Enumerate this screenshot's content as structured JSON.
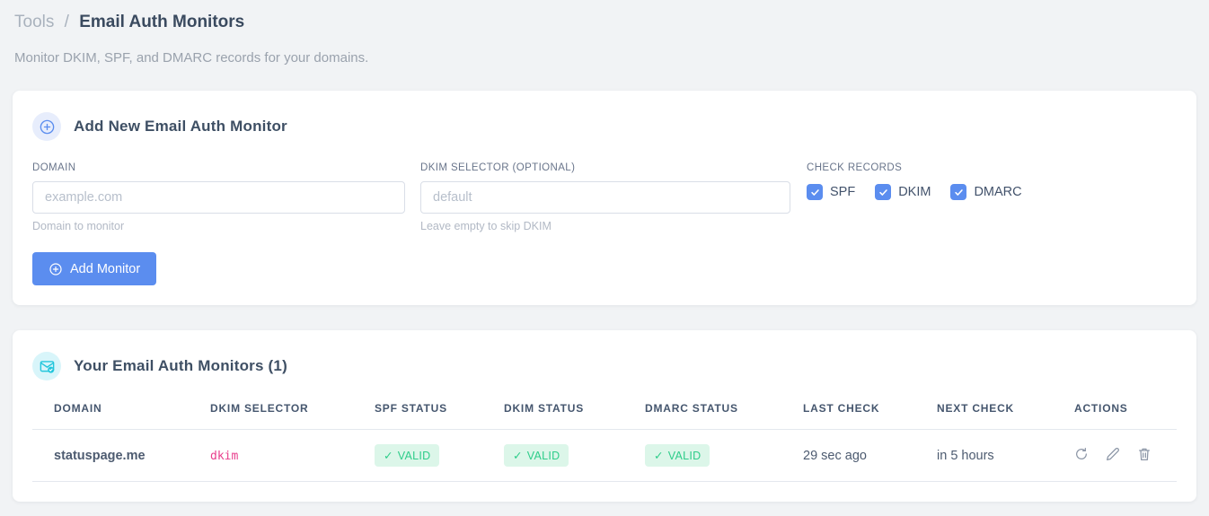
{
  "breadcrumb": {
    "parent": "Tools",
    "separator": "/",
    "current": "Email Auth Monitors"
  },
  "subtitle": "Monitor DKIM, SPF, and DMARC records for your domains.",
  "icons": {
    "check_glyph": "✓"
  },
  "add_form": {
    "title": "Add New Email Auth Monitor",
    "domain": {
      "label": "DOMAIN",
      "value": "",
      "placeholder": "example.com",
      "helper": "Domain to monitor"
    },
    "dkim_selector": {
      "label": "DKIM SELECTOR (OPTIONAL)",
      "value": "",
      "placeholder": "default",
      "helper": "Leave empty to skip DKIM"
    },
    "check_records": {
      "label": "CHECK RECORDS",
      "options": [
        {
          "label": "SPF",
          "checked": true
        },
        {
          "label": "DKIM",
          "checked": true
        },
        {
          "label": "DMARC",
          "checked": true
        }
      ]
    },
    "submit_label": "Add Monitor"
  },
  "monitors": {
    "title": "Your Email Auth Monitors (1)",
    "count": 1,
    "columns": [
      "DOMAIN",
      "DKIM SELECTOR",
      "SPF STATUS",
      "DKIM STATUS",
      "DMARC STATUS",
      "LAST CHECK",
      "NEXT CHECK",
      "ACTIONS"
    ],
    "rows": [
      {
        "domain": "statuspage.me",
        "dkim_selector": "dkim",
        "spf_status": "VALID",
        "dkim_status": "VALID",
        "dmarc_status": "VALID",
        "last_check": "29 sec ago",
        "next_check": "in 5 hours",
        "actions": [
          "refresh",
          "edit",
          "delete"
        ]
      }
    ]
  },
  "colors": {
    "accent_blue": "#5b8def",
    "badge_green_bg": "#dcf6e9",
    "badge_green_text": "#2ecd8a",
    "code_pink": "#e83e8c",
    "icon_cyan": "#23c6dc"
  }
}
